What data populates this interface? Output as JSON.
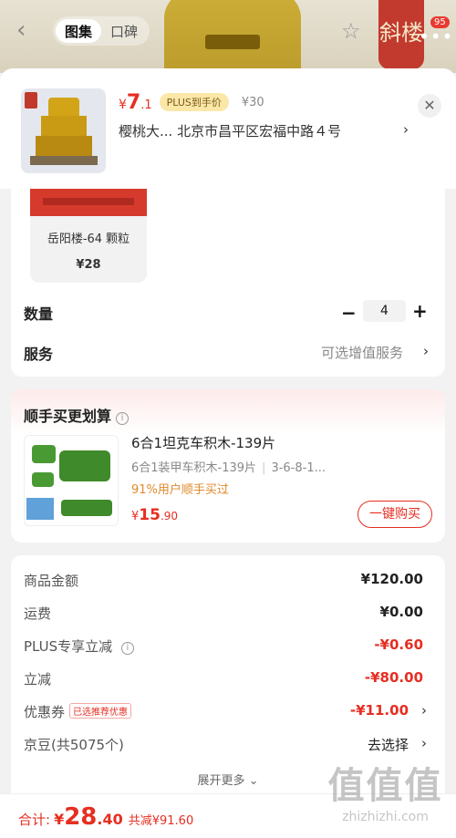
{
  "header": {
    "segments": [
      "图集",
      "口碑"
    ],
    "stamp_text": "斜楼",
    "badge_count": "95"
  },
  "product": {
    "price_symbol": "¥",
    "price_int": "7",
    "price_dec": ".1",
    "plus_label": "PLUS到手价",
    "original_price": "¥30",
    "address": "樱桃大...  北京市昌平区宏福中路４号"
  },
  "variant": {
    "name": "岳阳楼-64 颗粒",
    "price": "¥28"
  },
  "options": {
    "quantity_label": "数量",
    "quantity_value": "4",
    "service_label": "服务",
    "service_value": "可选增值服务"
  },
  "addon": {
    "title": "顺手买更划算",
    "name": "6合1坦克车积木-139片",
    "sub_left": "6合1装甲车积木-139片",
    "sub_right": "3-6-8-1...",
    "rate": "91%用户顺手买过",
    "price_symbol": "¥",
    "price_int": "15",
    "price_dec": ".90",
    "buy_label": "一键购买"
  },
  "summary": {
    "rows": [
      {
        "label": "商品金额",
        "value": "¥120.00"
      },
      {
        "label": "运费",
        "value": "¥0.00"
      },
      {
        "label": "PLUS专享立减",
        "value": "-¥0.60"
      },
      {
        "label": "立减",
        "value": "-¥80.00"
      },
      {
        "label": "优惠券",
        "tag": "已选推荐优惠",
        "value": "-¥11.00"
      },
      {
        "label": "京豆(共5075个)",
        "value": "去选择"
      }
    ],
    "expand_label": "展开更多"
  },
  "bottom": {
    "total_label": "合计:",
    "total_symbol": "¥",
    "total_int": "28",
    "total_dec": ".40",
    "saved": "共减¥91.60"
  },
  "watermark": {
    "big": "值值值",
    "small": "zhizhizhi.com"
  },
  "colors": {
    "accent_red": "#e62e21",
    "plus_gold": "#fbe7a8",
    "rate_orange": "#e0892a"
  }
}
